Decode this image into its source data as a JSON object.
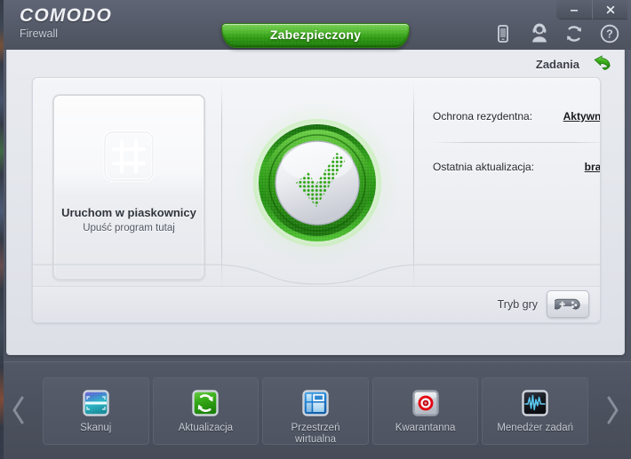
{
  "window": {
    "brand": "COMODO",
    "product": "Firewall",
    "minimize_label": "–",
    "close_label": "✕"
  },
  "header": {
    "status_tab": "Zabezpieczony",
    "icons": [
      {
        "name": "mobile-device-icon",
        "title": "Mobile"
      },
      {
        "name": "support-headset-icon",
        "title": "Support"
      },
      {
        "name": "sync-refresh-icon",
        "title": "Sync"
      },
      {
        "name": "help-question-icon",
        "title": "Help"
      }
    ]
  },
  "main": {
    "tasks_label": "Zadania",
    "sandbox": {
      "title": "Uruchom w piaskownicy",
      "subtitle": "Upuść program tutaj",
      "icon": "sandbox-grid-icon"
    },
    "shield": {
      "icon": "green-check-shield-icon",
      "state": "secure",
      "accent": "#2f9a14"
    },
    "status": [
      {
        "label": "Ochrona rezydentna:",
        "value": "Aktywna"
      },
      {
        "label": "Ostatnia aktualizacja:",
        "value": "brak"
      }
    ],
    "game_mode": {
      "label": "Tryb gry",
      "icon": "gamepad-icon"
    }
  },
  "toolbar": {
    "prev_label": "‹",
    "next_label": "›",
    "tiles": [
      {
        "label": "Skanuj",
        "icon": "scanner-icon"
      },
      {
        "label": "Aktualizacja",
        "icon": "update-refresh-icon"
      },
      {
        "label": "Przestrzeń\nwirtualna",
        "icon": "virtual-desktop-icon"
      },
      {
        "label": "Kwarantanna",
        "icon": "quarantine-target-icon"
      },
      {
        "label": "Menedżer zadań",
        "icon": "task-manager-waveform-icon"
      }
    ]
  },
  "colors": {
    "titlebar": "#575d6c",
    "toolbar": "#4c515e",
    "panel": "#e4e7ec",
    "green": "#2f9a14",
    "green_light": "#7bd15a"
  }
}
